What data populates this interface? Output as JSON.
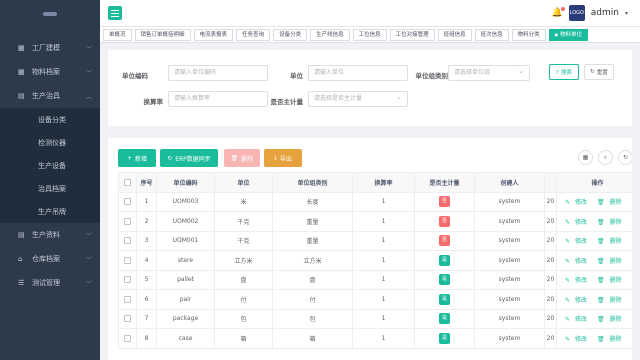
{
  "sidebar": {
    "items": [
      {
        "label": "工厂建模",
        "icon": "building-icon",
        "glyph": "▦"
      },
      {
        "label": "物料档案",
        "icon": "box-icon",
        "glyph": "▦"
      },
      {
        "label": "生产治具",
        "icon": "document-icon",
        "glyph": "▤",
        "expanded": true,
        "children": [
          "设备分类",
          "检测仪器",
          "生产设备",
          "治具档案",
          "生产吊牌"
        ]
      },
      {
        "label": "生产资料",
        "icon": "folder-icon",
        "glyph": "▤"
      },
      {
        "label": "仓库档案",
        "icon": "warehouse-icon",
        "glyph": "⌂"
      },
      {
        "label": "测试管理",
        "icon": "list-icon",
        "glyph": "☰"
      }
    ]
  },
  "header": {
    "username": "admin",
    "avatar_text": "LOGO"
  },
  "tabs": [
    {
      "label": "单概况",
      "active": false
    },
    {
      "label": "销售订单概括明细",
      "active": false
    },
    {
      "label": "电流表报表",
      "active": false
    },
    {
      "label": "任务查询",
      "active": false
    },
    {
      "label": "设备分类",
      "active": false
    },
    {
      "label": "生产线信息",
      "active": false
    },
    {
      "label": "工位信息",
      "active": false
    },
    {
      "label": "工位对接管理",
      "active": false
    },
    {
      "label": "班组信息",
      "active": false
    },
    {
      "label": "班次信息",
      "active": false
    },
    {
      "label": "物料分类",
      "active": false
    },
    {
      "label": "物料单位",
      "active": true
    }
  ],
  "search": {
    "unit_code_label": "单位编码",
    "unit_code_placeholder": "请输入单位编码",
    "unit_label": "单位",
    "unit_placeholder": "请输入单位",
    "unit_group_label": "单位组类别",
    "unit_group_placeholder": "请选择单位组",
    "ratio_label": "换算率",
    "ratio_placeholder": "请输入换算率",
    "is_main_label": "是否主计量",
    "is_main_placeholder": "请选择是否主计量",
    "search_button": "搜索",
    "reset_button": "重置"
  },
  "toolbar": {
    "add": "新增",
    "sync": "ERP数据同步",
    "delete": "删除",
    "export": "导出"
  },
  "table": {
    "headers": [
      "",
      "序号",
      "单位编码",
      "单位",
      "单位组类别",
      "换算率",
      "是否主计量",
      "创建人",
      "",
      "操作"
    ],
    "edit_label": "修改",
    "delete_label": "删除",
    "rows": [
      {
        "no": "1",
        "code": "UOM003",
        "unit": "米",
        "group": "长度",
        "ratio": "1",
        "main": "否",
        "main_flag": "no",
        "creator": "system",
        "date": "20"
      },
      {
        "no": "2",
        "code": "UOM002",
        "unit": "千克",
        "group": "重量",
        "ratio": "1",
        "main": "否",
        "main_flag": "no",
        "creator": "system",
        "date": "20"
      },
      {
        "no": "3",
        "code": "UOM001",
        "unit": "千克",
        "group": "重量",
        "ratio": "1",
        "main": "否",
        "main_flag": "no",
        "creator": "system",
        "date": "20"
      },
      {
        "no": "4",
        "code": "stere",
        "unit": "立方米",
        "group": "立方米",
        "ratio": "1",
        "main": "是",
        "main_flag": "yes",
        "creator": "system",
        "date": "20"
      },
      {
        "no": "5",
        "code": "pallet",
        "unit": "盘",
        "group": "盘",
        "ratio": "1",
        "main": "是",
        "main_flag": "yes",
        "creator": "system",
        "date": "20"
      },
      {
        "no": "6",
        "code": "pair",
        "unit": "付",
        "group": "付",
        "ratio": "1",
        "main": "是",
        "main_flag": "yes",
        "creator": "system",
        "date": "20"
      },
      {
        "no": "7",
        "code": "package",
        "unit": "包",
        "group": "包",
        "ratio": "1",
        "main": "是",
        "main_flag": "yes",
        "creator": "system",
        "date": "20"
      },
      {
        "no": "8",
        "code": "case",
        "unit": "箱",
        "group": "箱",
        "ratio": "1",
        "main": "是",
        "main_flag": "yes",
        "creator": "system",
        "date": "20"
      }
    ]
  },
  "colors": {
    "accent": "#1abc9c",
    "danger": "#f56c6c",
    "warning": "#e6a23c",
    "sidebar": "#2d3a4b"
  }
}
